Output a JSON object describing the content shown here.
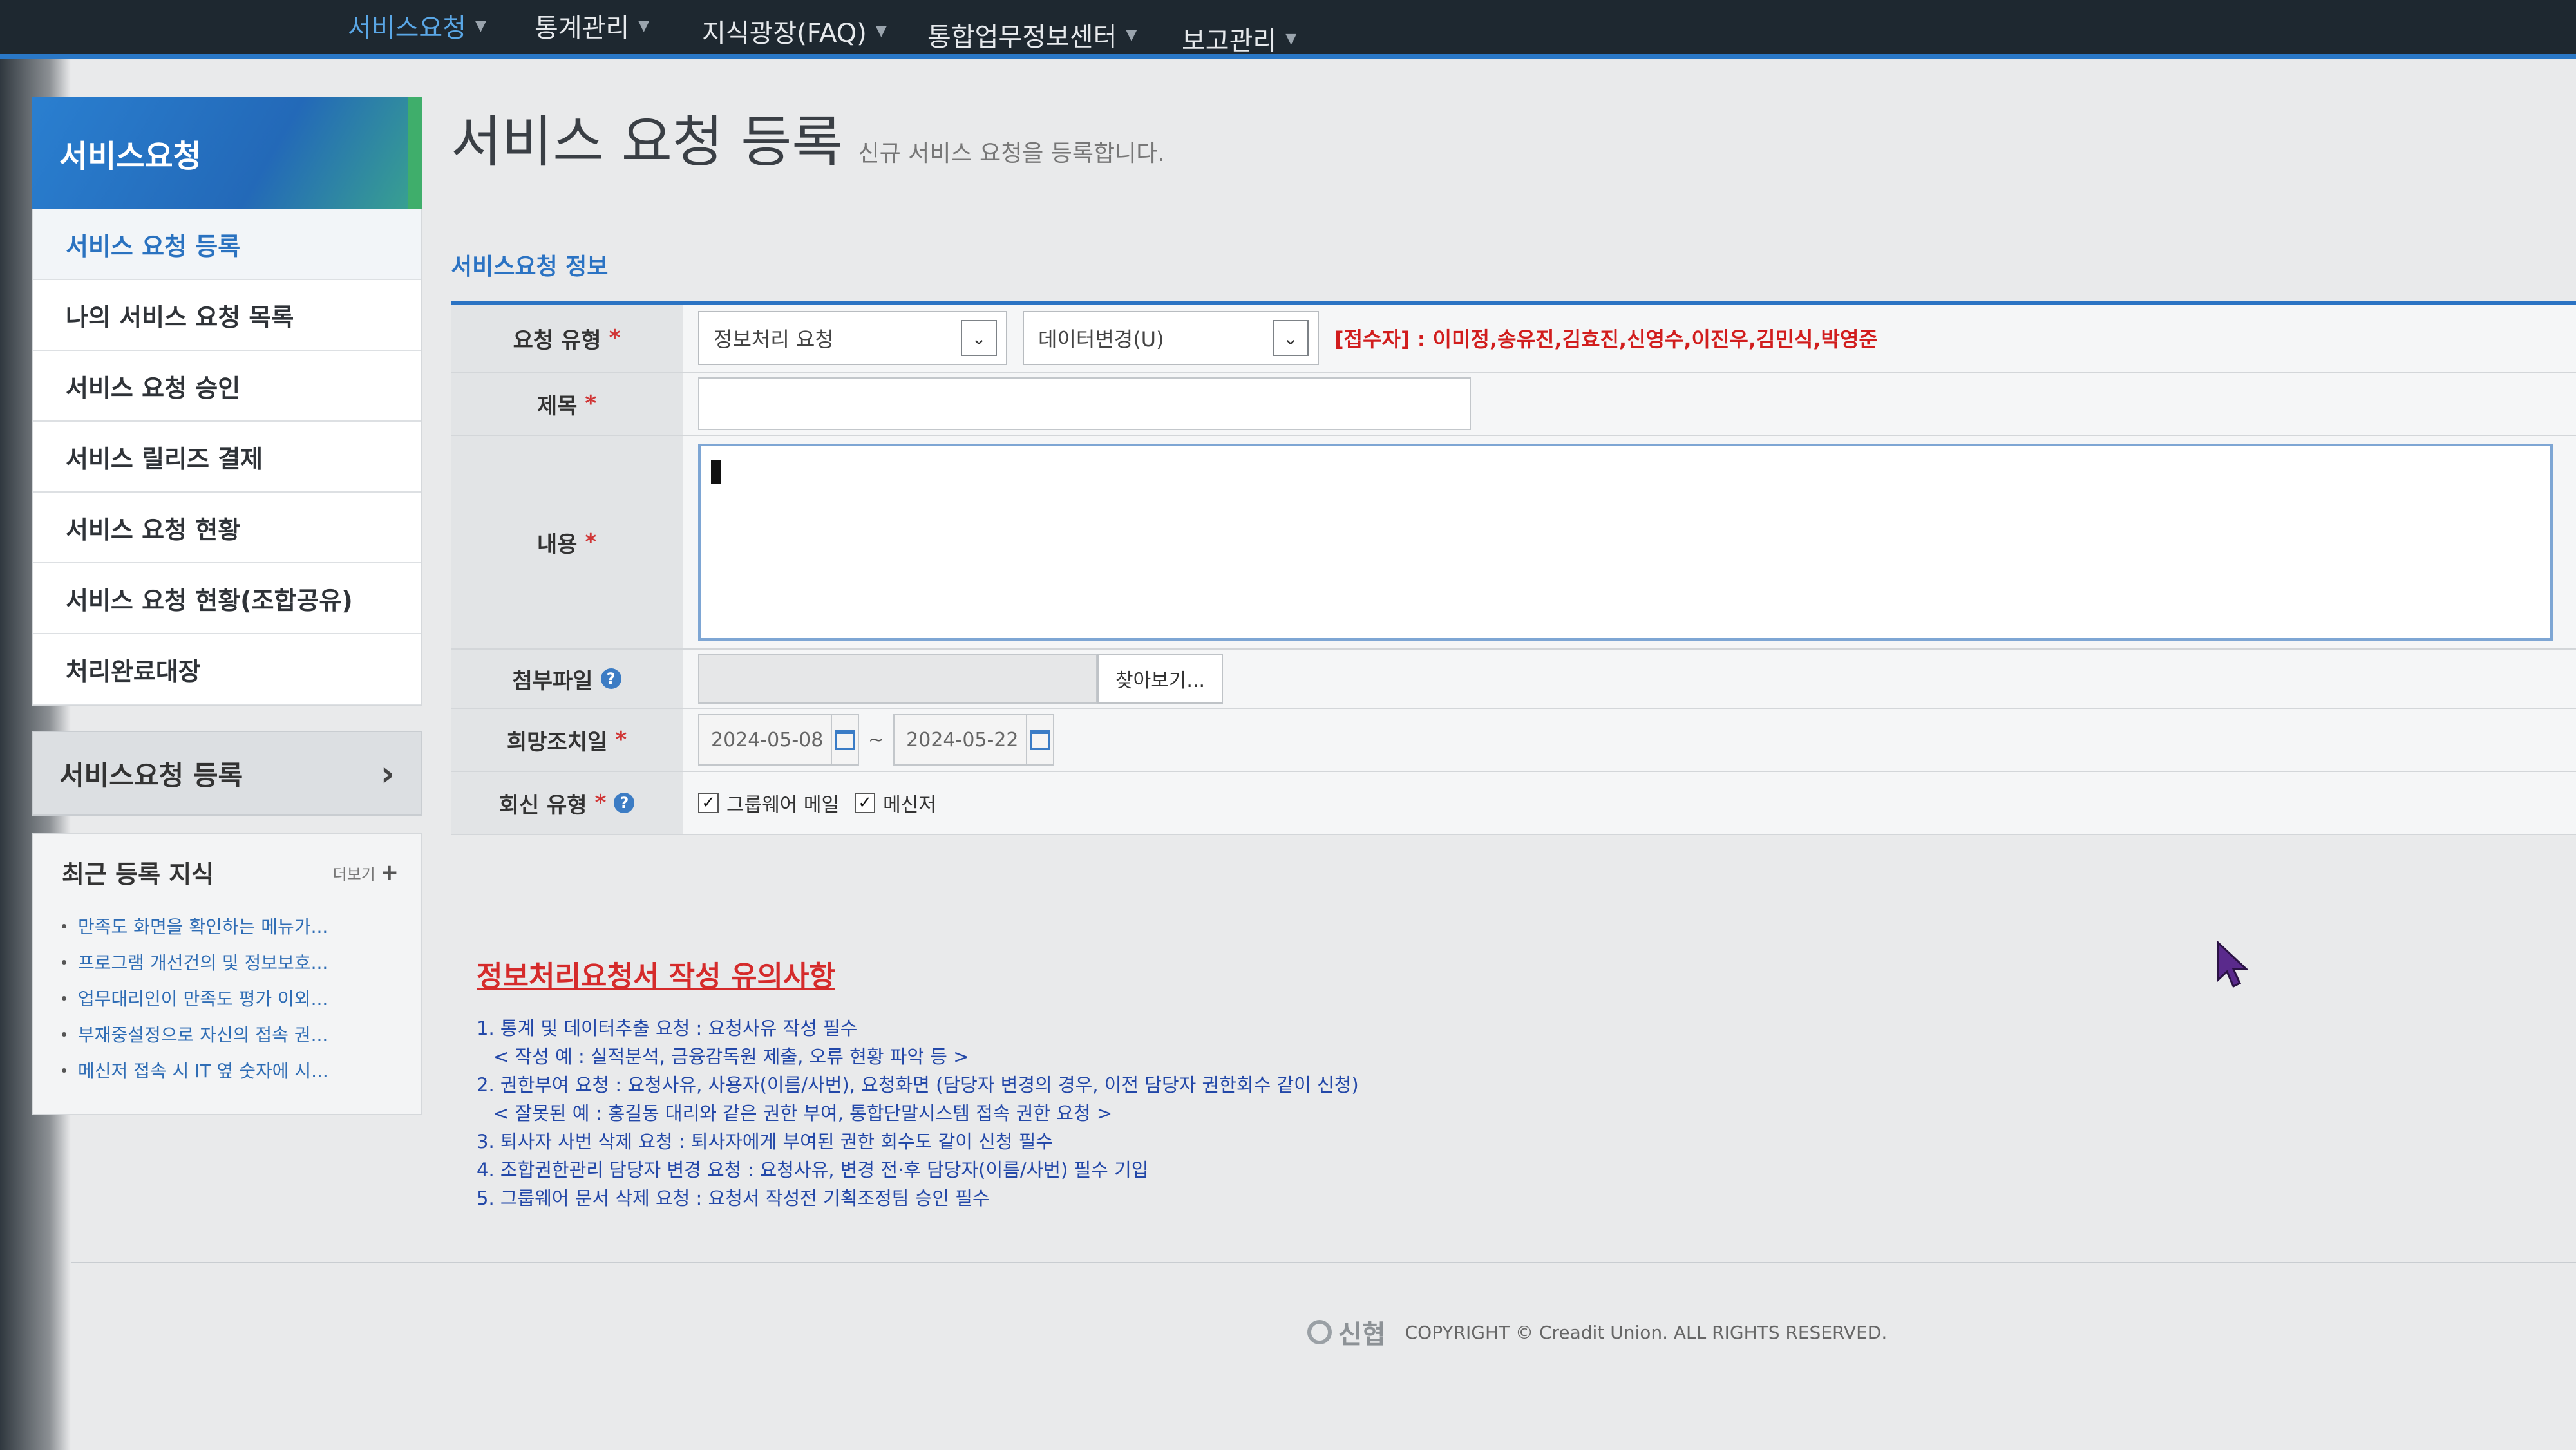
{
  "topnav": {
    "items": [
      {
        "label": "서비스요청"
      },
      {
        "label": "통계관리"
      },
      {
        "label": "지식광장(FAQ)"
      },
      {
        "label": "통합업무정보센터"
      },
      {
        "label": "보고관리"
      }
    ]
  },
  "sidebar": {
    "title": "서비스요청",
    "items": [
      {
        "label": "서비스 요청 등록"
      },
      {
        "label": "나의 서비스 요청 목록"
      },
      {
        "label": "서비스 요청 승인"
      },
      {
        "label": "서비스 릴리즈 결제"
      },
      {
        "label": "서비스 요청 현황"
      },
      {
        "label": "서비스 요청 현황(조합공유)"
      },
      {
        "label": "처리완료대장"
      }
    ],
    "shortcut_label": "서비스요청 등록",
    "recent": {
      "title": "최근 등록 지식",
      "more_label": "더보기",
      "items": [
        {
          "text": "만족도 화면을 확인하는 메뉴가..."
        },
        {
          "text": "프로그램 개선건의 및 정보보호..."
        },
        {
          "text": "업무대리인이 만족도 평가 이외..."
        },
        {
          "text": "부재중설정으로 자신의 접속 권..."
        },
        {
          "text": "메신저 접속 시 IT 옆 숫자에 시..."
        }
      ]
    }
  },
  "main": {
    "title": "서비스 요청 등록",
    "subtitle": "신규 서비스 요청을 등록합니다.",
    "section_label": "서비스요청 정보",
    "form": {
      "type_label": "요청 유형",
      "type_value": "정보처리 요청",
      "subtype_value": "데이터변경(U)",
      "receivers": "[접수자] : 이미정,송유진,김효진,신영수,이진우,김민식,박영준",
      "title_label": "제목",
      "title_value": "",
      "content_label": "내용",
      "attach_label": "첨부파일",
      "browse_label": "찾아보기...",
      "date_label": "희망조치일",
      "date_from": "2024-05-08",
      "date_sep": "~",
      "date_to": "2024-05-22",
      "reply_label": "회신 유형",
      "reply_opt1": "그룹웨어 메일",
      "reply_opt2": "메신저"
    }
  },
  "notice": {
    "title": "정보처리요청서 작성 유의사항",
    "lines": [
      {
        "text": "1. 통계 및 데이터추출 요청 : 요청사유 작성 필수"
      },
      {
        "text": "< 작성 예 : 실적분석, 금융감독원 제출, 오류 현황 파악 등 >"
      },
      {
        "text": "2. 권한부여 요청 : 요청사유, 사용자(이름/사번), 요청화면 (담당자 변경의 경우, 이전 담당자 권한회수 같이 신청)"
      },
      {
        "text": "< 잘못된 예 : 홍길동 대리와 같은 권한 부여, 통합단말시스템 접속 권한 요청 >"
      },
      {
        "text": "3. 퇴사자 사번 삭제 요청 : 퇴사자에게 부여된 권한 회수도 같이 신청 필수"
      },
      {
        "text": "4. 조합권한관리 담당자 변경 요청 : 요청사유, 변경 전·후 담당자(이름/사번) 필수 기입"
      },
      {
        "text": "5. 그룹웨어 문서 삭제 요청 : 요청서 작성전 기획조정팀 승인 필수"
      }
    ]
  },
  "footer": {
    "logo": "신협",
    "copyright": "COPYRIGHT © Creadit Union. ALL RIGHTS RESERVED."
  },
  "colors": {
    "accent": "#2b73c3",
    "warning": "#d52b2b",
    "nav_bg": "#1e2830"
  }
}
